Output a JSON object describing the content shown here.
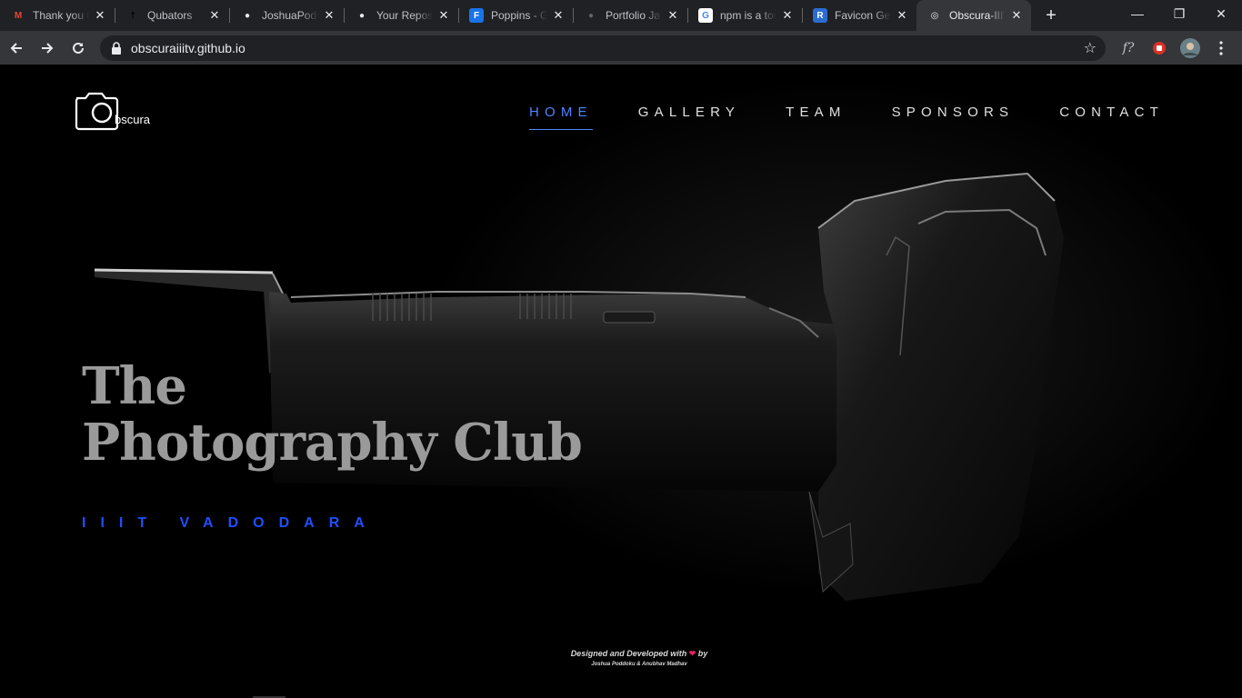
{
  "browser": {
    "tabs": [
      {
        "title": "Thank you f",
        "icon": "gmail-icon",
        "icon_glyph": "M",
        "icon_color": "#ea4335",
        "icon_bg": "transparent"
      },
      {
        "title": "Qubators",
        "icon": "qubators-icon",
        "icon_glyph": "†",
        "icon_color": "#000000",
        "icon_bg": "transparent"
      },
      {
        "title": "JoshuaPodd",
        "icon": "github-icon",
        "icon_glyph": "●",
        "icon_color": "#e8eaed",
        "icon_bg": "transparent"
      },
      {
        "title": "Your Reposi",
        "icon": "github-icon",
        "icon_glyph": "●",
        "icon_color": "#e8eaed",
        "icon_bg": "transparent"
      },
      {
        "title": "Poppins - G",
        "icon": "google-fonts-icon",
        "icon_glyph": "F",
        "icon_color": "#ffffff",
        "icon_bg": "#1a73e8"
      },
      {
        "title": "Portfolio Ja",
        "icon": "globe-icon",
        "icon_glyph": "●",
        "icon_color": "#5f6368",
        "icon_bg": "transparent"
      },
      {
        "title": "npm is a too",
        "icon": "google-icon",
        "icon_glyph": "G",
        "icon_color": "#4285f4",
        "icon_bg": "#ffffff"
      },
      {
        "title": "Favicon Ger",
        "icon": "realfavicon-icon",
        "icon_glyph": "R",
        "icon_color": "#ffffff",
        "icon_bg": "#2b6cd1"
      },
      {
        "title": "Obscura-IIIT",
        "icon": "obscura-icon",
        "icon_glyph": "◎",
        "icon_color": "#e8eaed",
        "icon_bg": "transparent",
        "active": true
      }
    ],
    "new_tab_glyph": "+",
    "window_controls": {
      "minimize": "—",
      "restore": "❐",
      "close": "✕"
    },
    "url": "obscuraiiitv.github.io",
    "extension_label": "f?"
  },
  "site": {
    "logo_text": "bscura",
    "nav": [
      {
        "label": "HOME",
        "active": true
      },
      {
        "label": "GALLERY",
        "active": false
      },
      {
        "label": "TEAM",
        "active": false
      },
      {
        "label": "SPONSORS",
        "active": false
      },
      {
        "label": "CONTACT",
        "active": false
      }
    ],
    "title_line1": "The",
    "title_line2": "Photography Club",
    "subtitle": "IIIT VADODARA",
    "footer_line1_pre": "Designed and Developed with",
    "footer_line1_post": "by",
    "footer_line2": "Joshua Poddoku & Anubhav Madhav",
    "accent_color": "#4d84ff",
    "subtitle_color": "#1f4fff"
  }
}
